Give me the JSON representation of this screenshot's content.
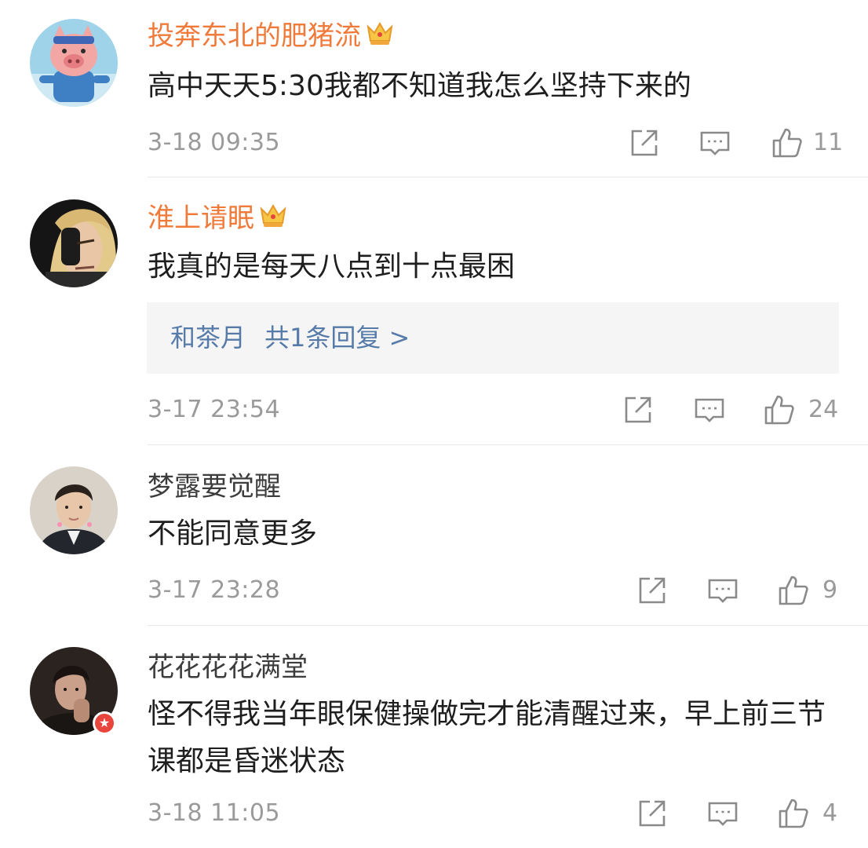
{
  "comments": [
    {
      "username": "投奔东北的肥猪流",
      "text": "高中天天5:30我都不知道我怎么坚持下来的",
      "time": "3-18 09:35",
      "likes": "11",
      "vip": true
    },
    {
      "username": "淮上请眠",
      "text": "我真的是每天八点到十点最困",
      "reply_author": "和茶月",
      "reply_summary": "共1条回复 >",
      "time": "3-17 23:54",
      "likes": "24",
      "vip": true
    },
    {
      "username": "梦露要觉醒",
      "text": "不能同意更多",
      "time": "3-17 23:28",
      "likes": "9",
      "vip": false
    },
    {
      "username": "花花花花满堂",
      "text": "怪不得我当年眼保健操做完才能清醒过来，早上前三节课都是昏迷状态",
      "time": "3-18 11:05",
      "likes": "4",
      "vip": false
    }
  ],
  "colors": {
    "vip_name": "#f07a3a",
    "reply_link": "#567ba8",
    "meta": "#9a9a9a"
  },
  "icons": [
    "share-icon",
    "comment-icon",
    "like-icon",
    "crown-icon"
  ]
}
